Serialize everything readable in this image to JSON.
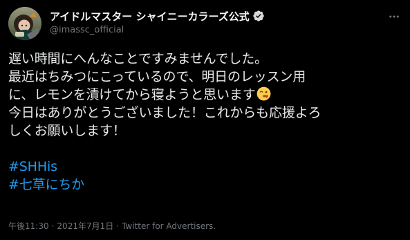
{
  "account": {
    "display_name": "アイドルマスター シャイニーカラーズ公式",
    "handle": "@imassc_official",
    "verified_icon": "verified-badge-icon",
    "avatar_label": "avatar"
  },
  "tweet": {
    "lines": [
      "遅い時間にへんなことですみませんでした。",
      "最近はちみつにこっているので、明日のレッスン用",
      "に、レモンを漬けてから寝ようと思います",
      "今日はありがとうございました！これからも応援よろ",
      "しくお願いします！"
    ],
    "emoji": "face-blowing-a-kiss-emoji",
    "hashtags": [
      "#SHHis",
      "#七草にちか"
    ]
  },
  "meta": {
    "time": "午後11:30",
    "separator": "·",
    "date": "2021年7月1日",
    "source": "Twitter for Advertisers."
  },
  "colors": {
    "background": "#000000",
    "text": "#e7e9ea",
    "muted": "#71767b",
    "link": "#1d9bf0",
    "verified": "#d9d9d9"
  }
}
